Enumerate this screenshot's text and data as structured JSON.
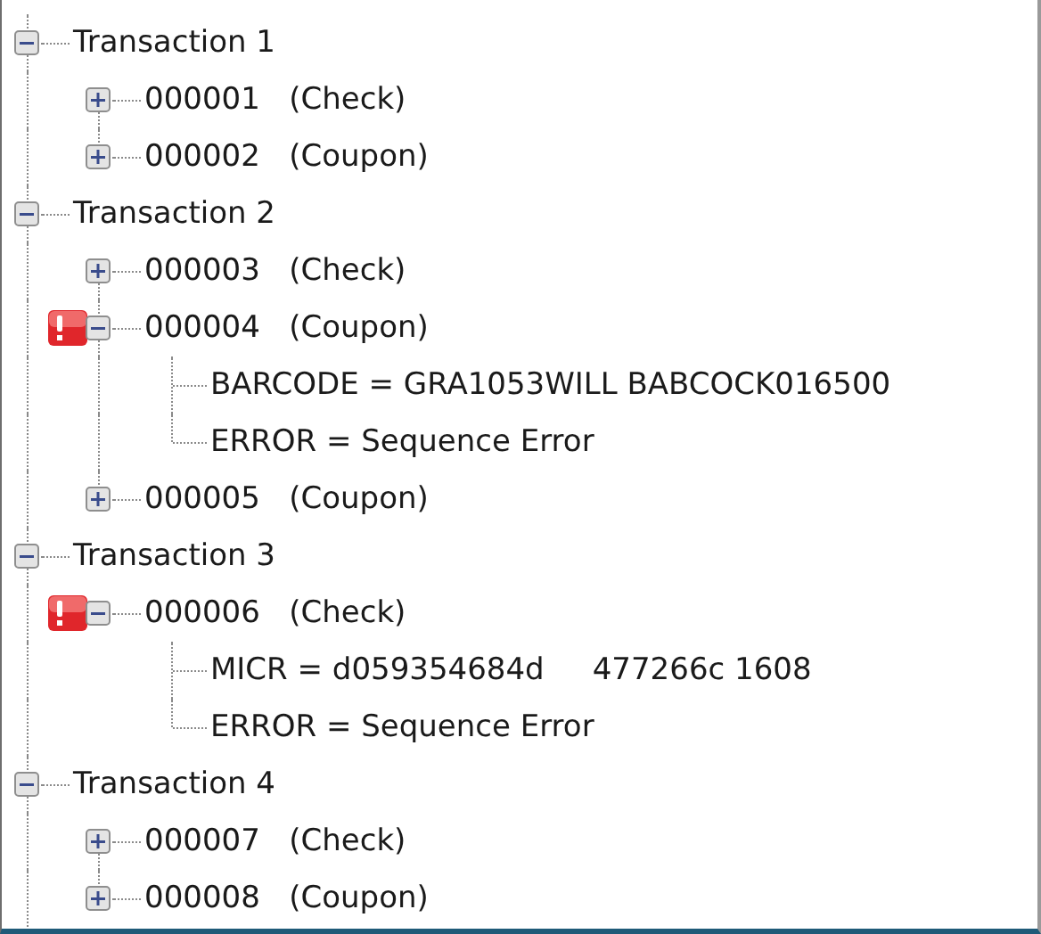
{
  "tree": [
    {
      "label": "Transaction 1",
      "expanded": true,
      "items": [
        {
          "label": "000001   (Check)",
          "expanded": false,
          "error": false
        },
        {
          "label": "000002   (Coupon)",
          "expanded": false,
          "error": false
        }
      ]
    },
    {
      "label": "Transaction 2",
      "expanded": true,
      "items": [
        {
          "label": "000003   (Check)",
          "expanded": false,
          "error": false
        },
        {
          "label": "000004   (Coupon)",
          "expanded": true,
          "error": true,
          "children": [
            {
              "label": "BARCODE = GRA1053WILL BABCOCK016500"
            },
            {
              "label": "ERROR = Sequence Error"
            }
          ]
        },
        {
          "label": "000005   (Coupon)",
          "expanded": false,
          "error": false
        }
      ]
    },
    {
      "label": "Transaction 3",
      "expanded": true,
      "items": [
        {
          "label": "000006   (Check)",
          "expanded": true,
          "error": true,
          "children": [
            {
              "label": "MICR = d059354684d     477266c 1608"
            },
            {
              "label": "ERROR = Sequence Error"
            }
          ]
        }
      ]
    },
    {
      "label": "Transaction 4",
      "expanded": true,
      "items": [
        {
          "label": "000007   (Check)",
          "expanded": false,
          "error": false
        },
        {
          "label": "000008   (Coupon)",
          "expanded": false,
          "error": false
        }
      ]
    }
  ]
}
